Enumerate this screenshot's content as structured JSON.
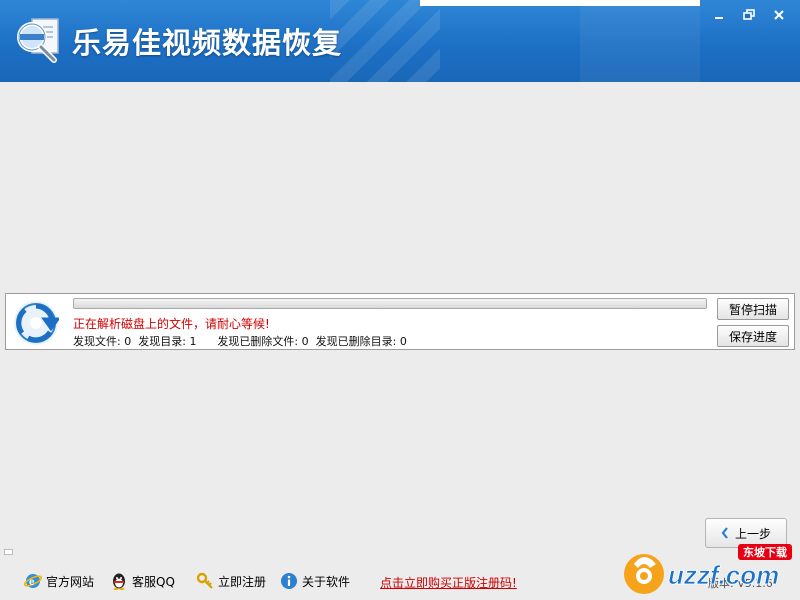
{
  "app": {
    "title": "乐易佳视频数据恢复"
  },
  "scan": {
    "progress": 0,
    "status": "正在解析磁盘上的文件，请耐心等候!",
    "counts": {
      "found_files_label": "发现文件:",
      "found_files": "0",
      "found_dirs_label": "发现目录:",
      "found_dirs": "1",
      "deleted_files_label": "发现已删除文件:",
      "deleted_files": "0",
      "deleted_dirs_label": "发现已删除目录:",
      "deleted_dirs": "0"
    },
    "pause_label": "暂停扫描",
    "save_label": "保存进度"
  },
  "nav": {
    "prev_label": "上一步"
  },
  "footer": {
    "website": "官方网站",
    "qq": "客服QQ",
    "register": "立即注册",
    "about": "关于软件",
    "buy": "点击立即购买正版注册码!",
    "version": "版本: V5.1.6"
  },
  "watermark": {
    "text": "uzzf.com",
    "tag": "东坡下载"
  },
  "icons": {
    "app": "magnifier-document-icon",
    "scan": "spinning-arrows-icon",
    "website": "ie-browser-icon",
    "qq": "qq-penguin-icon",
    "register": "key-icon",
    "about": "info-icon"
  },
  "colors": {
    "title_bar": "#1c6fc4",
    "status_text": "#d00000",
    "buy_link": "#cc0000"
  }
}
